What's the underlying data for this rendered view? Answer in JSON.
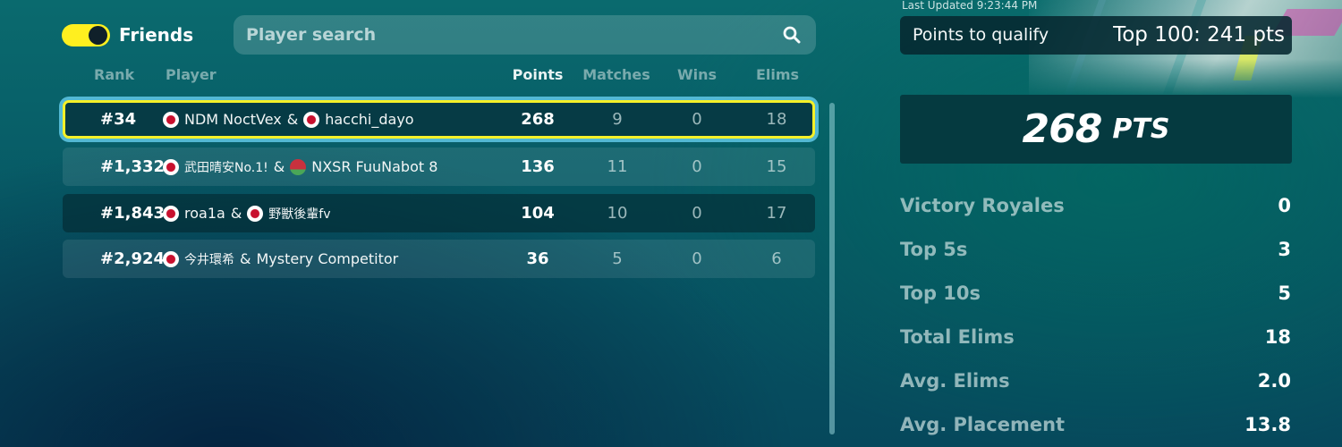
{
  "toolbar": {
    "friends_label": "Friends",
    "friends_toggle_on": true,
    "toggle_color": "#ffef1f",
    "search_placeholder": "Player search",
    "search_value": ""
  },
  "columns": {
    "rank": "Rank",
    "player": "Player",
    "points": "Points",
    "matches": "Matches",
    "wins": "Wins",
    "elims": "Elims"
  },
  "rows": [
    {
      "rank": "#34",
      "player1": {
        "flag": "jp",
        "name": "NDM NoctVex"
      },
      "separator": "&",
      "player2": {
        "flag": "jp",
        "name": "hacchi_dayo"
      },
      "points": "268",
      "matches": "9",
      "wins": "0",
      "elims": "18",
      "selected": true
    },
    {
      "rank": "#1,332",
      "player1": {
        "flag": "jp",
        "name": "武田晴安No.1!"
      },
      "separator": "&",
      "player2": {
        "flag": "by",
        "name": "NXSR FuuNabot 8"
      },
      "points": "136",
      "matches": "11",
      "wins": "0",
      "elims": "15",
      "selected": false
    },
    {
      "rank": "#1,843",
      "player1": {
        "flag": "jp",
        "name": "roa1a"
      },
      "separator": "&",
      "player2": {
        "flag": "jp",
        "name": "野獣後輩fv"
      },
      "points": "104",
      "matches": "10",
      "wins": "0",
      "elims": "17",
      "selected": false
    },
    {
      "rank": "#2,924",
      "player1": {
        "flag": "jp",
        "name": "今井環希"
      },
      "separator": "&",
      "player2": {
        "flag": "",
        "name": "Mystery Competitor"
      },
      "points": "36",
      "matches": "5",
      "wins": "0",
      "elims": "6",
      "selected": false
    }
  ],
  "summary": {
    "last_updated": "Last Updated 9:23:44 PM",
    "qualify_label": "Points to qualify",
    "qualify_value": "Top 100: 241 pts",
    "total_points": "268",
    "total_unit": "PTS",
    "stats": [
      {
        "label": "Victory Royales",
        "value": "0"
      },
      {
        "label": "Top 5s",
        "value": "3"
      },
      {
        "label": "Top 10s",
        "value": "5"
      },
      {
        "label": "Total Elims",
        "value": "18"
      },
      {
        "label": "Avg. Elims",
        "value": "2.0"
      },
      {
        "label": "Avg. Placement",
        "value": "13.8"
      }
    ]
  },
  "colors": {
    "highlight_border": "#f5f028",
    "highlight_glow": "#5fc8e6",
    "flag_jp": "#c8102e"
  },
  "icons": {
    "search": "search-icon",
    "toggle": "toggle-icon"
  }
}
